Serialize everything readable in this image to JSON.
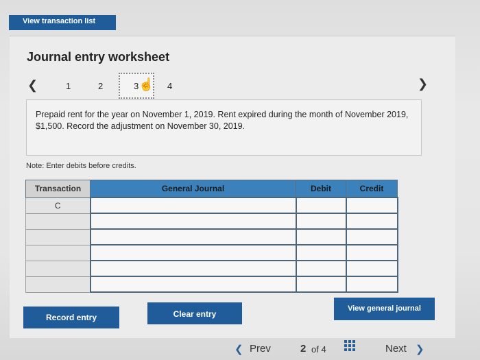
{
  "header": {
    "view_list_label": "View transaction list"
  },
  "worksheet": {
    "title": "Journal entry worksheet",
    "steps": [
      "1",
      "2",
      "3",
      "4"
    ],
    "description": "Prepaid rent for the year on November 1, 2019. Rent expired during the month of November 2019, $1,500. Record the adjustment on November 30, 2019.",
    "note": "Note: Enter debits before credits."
  },
  "table": {
    "headers": [
      "Transaction",
      "General Journal",
      "Debit",
      "Credit"
    ],
    "rows": [
      [
        "C",
        "",
        "",
        ""
      ],
      [
        "",
        "",
        "",
        ""
      ],
      [
        "",
        "",
        "",
        ""
      ],
      [
        "",
        "",
        "",
        ""
      ],
      [
        "",
        "",
        "",
        ""
      ],
      [
        "",
        "",
        "",
        ""
      ]
    ]
  },
  "buttons": {
    "record": "Record entry",
    "clear": "Clear entry",
    "view_journal": "View general journal"
  },
  "pager": {
    "prev": "Prev",
    "current": "2",
    "of_label": "of 4",
    "next": "Next"
  }
}
